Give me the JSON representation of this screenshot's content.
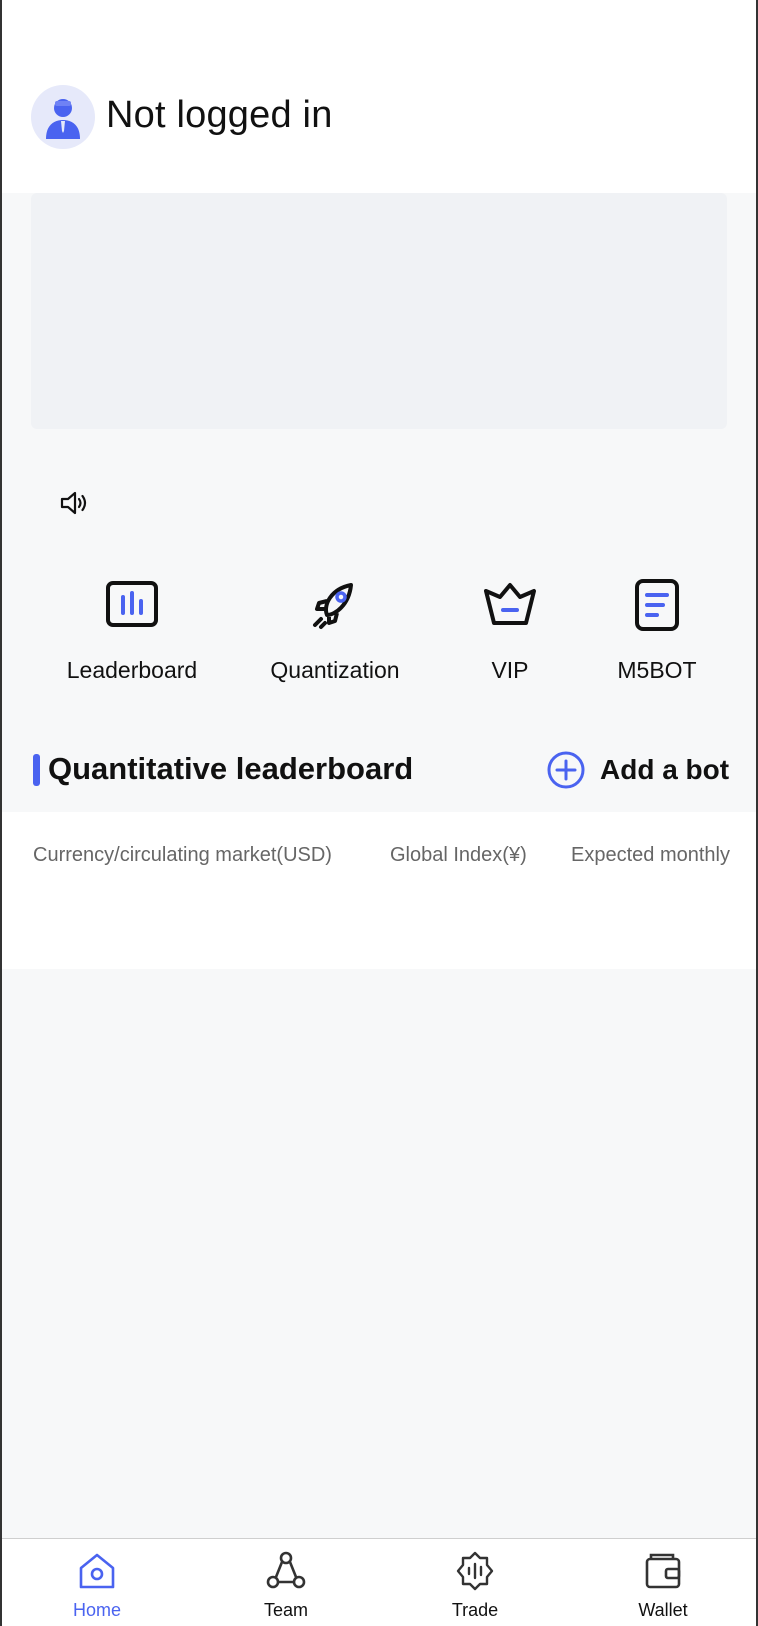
{
  "header": {
    "login_status": "Not logged in"
  },
  "shortcuts": [
    {
      "label": "Leaderboard",
      "icon": "bar-chart-icon"
    },
    {
      "label": "Quantization",
      "icon": "rocket-icon"
    },
    {
      "label": "VIP",
      "icon": "crown-icon"
    },
    {
      "label": "M5BOT",
      "icon": "document-icon"
    }
  ],
  "section": {
    "title": "Quantitative leaderboard",
    "add_bot_label": "Add a bot"
  },
  "table": {
    "columns": [
      "Currency/circulating market(USD)",
      "Global Index(¥)",
      "Expected monthly"
    ]
  },
  "tabbar": {
    "tabs": [
      {
        "label": "Home",
        "icon": "home-icon",
        "active": true
      },
      {
        "label": "Team",
        "icon": "team-icon",
        "active": false
      },
      {
        "label": "Trade",
        "icon": "trade-icon",
        "active": false
      },
      {
        "label": "Wallet",
        "icon": "wallet-icon",
        "active": false
      }
    ]
  },
  "colors": {
    "accent": "#4a63f0",
    "text": "#111111",
    "muted": "#666666",
    "background": "#f7f8f9"
  }
}
